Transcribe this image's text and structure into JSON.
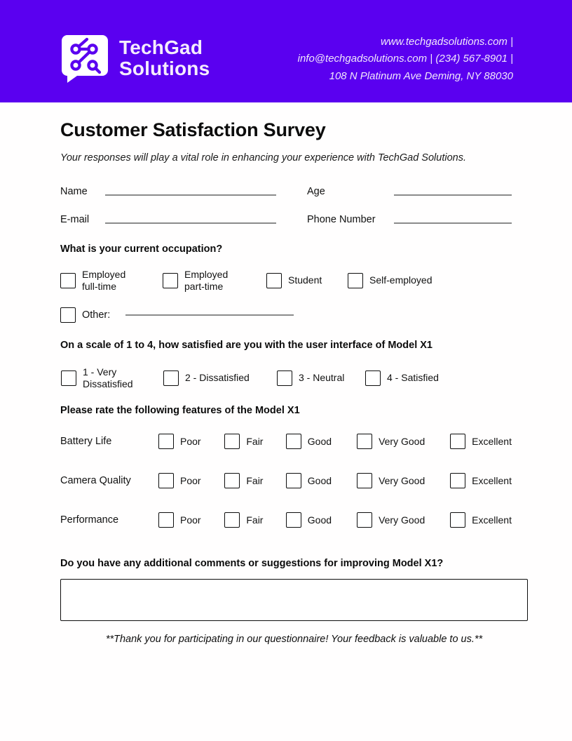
{
  "brand": {
    "name": "TechGad\nSolutions",
    "logo_icon": "circuit-nodes-icon"
  },
  "header": {
    "contact": "www.techgadsolutions.com |\ninfo@techgadsolutions.com | (234) 567-8901 |\n108 N Platinum Ave Deming, NY 88030",
    "background_color": "#5A00F0",
    "accent_circle_color": "#D濃"
  },
  "survey": {
    "title": "Customer Satisfaction Survey",
    "subtitle": "Your responses will play a vital role in enhancing your experience with TechGad Solutions."
  },
  "contact_fields": {
    "rows": [
      {
        "left_label": "Name",
        "left_value": "",
        "right_label": "Age",
        "right_value": ""
      },
      {
        "left_label": "E-mail",
        "left_value": "",
        "right_label": "Phone Number",
        "right_value": ""
      }
    ]
  },
  "occupation": {
    "question": "What is your current occupation?",
    "options": [
      "Employed\nfull-time",
      "Employed\npart-time",
      "Student",
      "Self-employed"
    ],
    "other_label": "Other:",
    "other_value": ""
  },
  "satisfaction": {
    "question": "On a scale of 1 to 4, how satisfied are you with the user interface of Model X1",
    "options": [
      "1 - Very\nDissatisfied",
      "2 - Dissatisfied",
      "3 - Neutral",
      "4 - Satisfied"
    ]
  },
  "features": {
    "question": "Please rate the following features of the Model X1",
    "scale": [
      "Poor",
      "Fair",
      "Good",
      "Very Good",
      "Excellent"
    ],
    "rows": [
      {
        "feature": "Battery Life"
      },
      {
        "feature": "Camera Quality"
      },
      {
        "feature": "Performance"
      }
    ]
  },
  "comments": {
    "question": "Do you have any additional comments or suggestions for improving Model X1?",
    "value": "",
    "placeholder": ""
  },
  "footer": {
    "thanks": "**Thank you for participating in our questionnaire! Your feedback is valuable to us.**"
  }
}
